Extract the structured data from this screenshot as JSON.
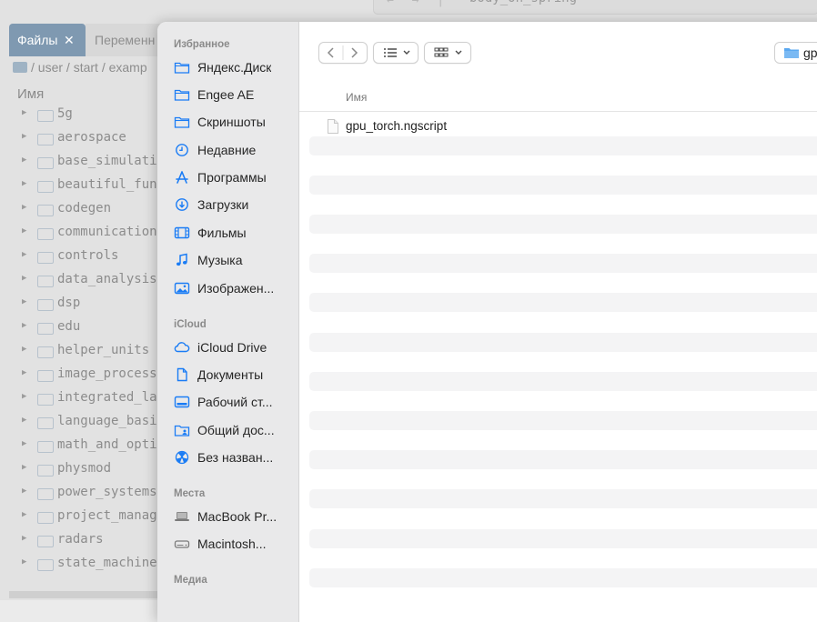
{
  "background": {
    "document_title": "body_on_spring",
    "tabs": [
      {
        "label": "Файлы",
        "close": "✕"
      },
      {
        "label": "Переменн"
      }
    ],
    "path": [
      "/",
      "user",
      "/",
      "start",
      "/",
      "examp"
    ],
    "column_header": "Имя",
    "tree_items": [
      "5g",
      "aerospace",
      "base_simulatio",
      "beautiful_func",
      "codegen",
      "communication",
      "controls",
      "data_analysis",
      "dsp",
      "edu",
      "helper_units",
      "image_process",
      "integrated_la",
      "language_basic",
      "math_and_optim",
      "physmod",
      "power_systems",
      "project_manag",
      "radars",
      "state_machine"
    ]
  },
  "dialog": {
    "sidebar": {
      "favorites_title": "Избранное",
      "favorites": [
        {
          "label": "Яндекс.Диск",
          "icon": "folder-icon"
        },
        {
          "label": "Engee AE",
          "icon": "folder-icon"
        },
        {
          "label": "Скриншоты",
          "icon": "folder-icon"
        },
        {
          "label": "Недавние",
          "icon": "clock-icon"
        },
        {
          "label": "Программы",
          "icon": "apps-icon"
        },
        {
          "label": "Загрузки",
          "icon": "download-icon"
        },
        {
          "label": "Фильмы",
          "icon": "film-icon"
        },
        {
          "label": "Музыка",
          "icon": "music-icon"
        },
        {
          "label": "Изображен...",
          "icon": "photo-icon"
        }
      ],
      "icloud_title": "iCloud",
      "icloud": [
        {
          "label": "iCloud Drive",
          "icon": "cloud-icon"
        },
        {
          "label": "Документы",
          "icon": "document-icon"
        },
        {
          "label": "Рабочий ст...",
          "icon": "desktop-icon"
        },
        {
          "label": "Общий дос...",
          "icon": "shared-folder-icon"
        },
        {
          "label": "Без назван...",
          "icon": "radiation-icon"
        }
      ],
      "locations_title": "Места",
      "locations": [
        {
          "label": "MacBook Pr...",
          "icon": "laptop-icon"
        },
        {
          "label": "Macintosh...",
          "icon": "drive-icon"
        }
      ],
      "media_title": "Медиа"
    },
    "toolbar": {
      "location_label": "gp"
    },
    "column_header": "Имя",
    "files": [
      {
        "name": "gpu_torch.ngscript"
      }
    ],
    "accent_color": "#1a7cf5"
  }
}
